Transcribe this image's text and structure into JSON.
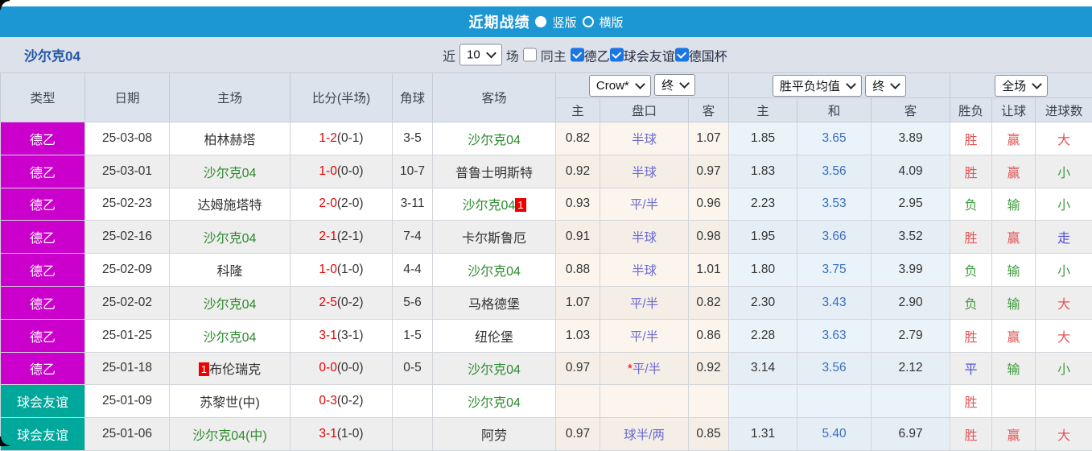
{
  "banner": {
    "title": "近期战绩",
    "vertical_label": "竖版",
    "horizontal_label": "横版",
    "selected_layout": "竖版"
  },
  "filter": {
    "team": "沙尔克04",
    "near_label": "近",
    "count": "10",
    "games_label": "场",
    "same_home_label": "同主",
    "same_home_checked": false,
    "league_filters": [
      "德乙",
      "球会友谊",
      "德国杯"
    ],
    "league_checked": [
      true,
      true,
      true
    ]
  },
  "table": {
    "main_headers": [
      "类型",
      "日期",
      "主场",
      "比分(半场)",
      "角球",
      "客场"
    ],
    "sub_headers": [
      "主",
      "盘口",
      "客",
      "主",
      "和",
      "客",
      "胜负",
      "让球",
      "进球数"
    ],
    "dropdowns": {
      "company": "Crow*",
      "company_period": "终",
      "avg": "胜平负均值",
      "avg_period": "终",
      "scope": "全场"
    },
    "rows": [
      {
        "type": "德乙",
        "type_class": "league-de2",
        "date": "25-03-08",
        "home": {
          "name": "柏林赫塔",
          "green": false,
          "badge": ""
        },
        "score": "1-2",
        "half": "(0-1)",
        "corners": "3-5",
        "away": {
          "name": "沙尔克04",
          "green": true,
          "badge": ""
        },
        "ah": {
          "home": "0.82",
          "line": "半球",
          "away": "1.07",
          "star": false
        },
        "op": {
          "home": "1.85",
          "draw": "3.65",
          "away": "3.89"
        },
        "result": {
          "text": "胜",
          "cls": "c-red"
        },
        "spread": {
          "text": "赢",
          "cls": "c-red"
        },
        "goals": {
          "text": "大",
          "cls": "c-red"
        }
      },
      {
        "type": "德乙",
        "type_class": "league-de2",
        "date": "25-03-01",
        "home": {
          "name": "沙尔克04",
          "green": true,
          "badge": ""
        },
        "score": "1-0",
        "half": "(0-0)",
        "corners": "10-7",
        "away": {
          "name": "普鲁士明斯特",
          "green": false,
          "badge": ""
        },
        "ah": {
          "home": "0.92",
          "line": "半球",
          "away": "0.97",
          "star": false
        },
        "op": {
          "home": "1.83",
          "draw": "3.56",
          "away": "4.09"
        },
        "result": {
          "text": "胜",
          "cls": "c-red"
        },
        "spread": {
          "text": "赢",
          "cls": "c-red"
        },
        "goals": {
          "text": "小",
          "cls": "c-green"
        }
      },
      {
        "type": "德乙",
        "type_class": "league-de2",
        "date": "25-02-23",
        "home": {
          "name": "达姆施塔特",
          "green": false,
          "badge": ""
        },
        "score": "2-0",
        "half": "(2-0)",
        "corners": "3-11",
        "away": {
          "name": "沙尔克04",
          "green": true,
          "badge": "1"
        },
        "ah": {
          "home": "0.93",
          "line": "平/半",
          "away": "0.96",
          "star": false
        },
        "op": {
          "home": "2.23",
          "draw": "3.53",
          "away": "2.95"
        },
        "result": {
          "text": "负",
          "cls": "c-green"
        },
        "spread": {
          "text": "输",
          "cls": "c-green"
        },
        "goals": {
          "text": "小",
          "cls": "c-green"
        }
      },
      {
        "type": "德乙",
        "type_class": "league-de2",
        "date": "25-02-16",
        "home": {
          "name": "沙尔克04",
          "green": true,
          "badge": ""
        },
        "score": "2-1",
        "half": "(2-1)",
        "corners": "7-4",
        "away": {
          "name": "卡尔斯鲁厄",
          "green": false,
          "badge": ""
        },
        "ah": {
          "home": "0.91",
          "line": "半球",
          "away": "0.98",
          "star": false
        },
        "op": {
          "home": "1.95",
          "draw": "3.66",
          "away": "3.52"
        },
        "result": {
          "text": "胜",
          "cls": "c-red"
        },
        "spread": {
          "text": "赢",
          "cls": "c-red"
        },
        "goals": {
          "text": "走",
          "cls": "c-blue"
        }
      },
      {
        "type": "德乙",
        "type_class": "league-de2",
        "date": "25-02-09",
        "home": {
          "name": "科隆",
          "green": false,
          "badge": ""
        },
        "score": "1-0",
        "half": "(1-0)",
        "corners": "4-4",
        "away": {
          "name": "沙尔克04",
          "green": true,
          "badge": ""
        },
        "ah": {
          "home": "0.88",
          "line": "半球",
          "away": "1.01",
          "star": false
        },
        "op": {
          "home": "1.80",
          "draw": "3.75",
          "away": "3.99"
        },
        "result": {
          "text": "负",
          "cls": "c-green"
        },
        "spread": {
          "text": "输",
          "cls": "c-green"
        },
        "goals": {
          "text": "小",
          "cls": "c-green"
        }
      },
      {
        "type": "德乙",
        "type_class": "league-de2",
        "date": "25-02-02",
        "home": {
          "name": "沙尔克04",
          "green": true,
          "badge": ""
        },
        "score": "2-5",
        "half": "(0-2)",
        "corners": "5-6",
        "away": {
          "name": "马格德堡",
          "green": false,
          "badge": ""
        },
        "ah": {
          "home": "1.07",
          "line": "平/半",
          "away": "0.82",
          "star": false
        },
        "op": {
          "home": "2.30",
          "draw": "3.43",
          "away": "2.90"
        },
        "result": {
          "text": "负",
          "cls": "c-green"
        },
        "spread": {
          "text": "输",
          "cls": "c-green"
        },
        "goals": {
          "text": "大",
          "cls": "c-red"
        }
      },
      {
        "type": "德乙",
        "type_class": "league-de2",
        "date": "25-01-25",
        "home": {
          "name": "沙尔克04",
          "green": true,
          "badge": ""
        },
        "score": "3-1",
        "half": "(3-1)",
        "corners": "1-5",
        "away": {
          "name": "纽伦堡",
          "green": false,
          "badge": ""
        },
        "ah": {
          "home": "1.03",
          "line": "平/半",
          "away": "0.86",
          "star": false
        },
        "op": {
          "home": "2.28",
          "draw": "3.63",
          "away": "2.79"
        },
        "result": {
          "text": "胜",
          "cls": "c-red"
        },
        "spread": {
          "text": "赢",
          "cls": "c-red"
        },
        "goals": {
          "text": "大",
          "cls": "c-red"
        }
      },
      {
        "type": "德乙",
        "type_class": "league-de2",
        "date": "25-01-18",
        "home": {
          "name": "布伦瑞克",
          "green": false,
          "badge": "1"
        },
        "score": "0-0",
        "half": "(0-0)",
        "corners": "0-5",
        "away": {
          "name": "沙尔克04",
          "green": true,
          "badge": ""
        },
        "ah": {
          "home": "0.97",
          "line": "平/半",
          "away": "0.92",
          "star": true
        },
        "op": {
          "home": "3.14",
          "draw": "3.56",
          "away": "2.12"
        },
        "result": {
          "text": "平",
          "cls": "c-blue"
        },
        "spread": {
          "text": "输",
          "cls": "c-green"
        },
        "goals": {
          "text": "小",
          "cls": "c-green"
        }
      },
      {
        "type": "球会友谊",
        "type_class": "league-friendly",
        "date": "25-01-09",
        "home": {
          "name": "苏黎世(中)",
          "green": false,
          "badge": ""
        },
        "score": "0-3",
        "half": "(0-2)",
        "corners": "",
        "away": {
          "name": "沙尔克04",
          "green": true,
          "badge": ""
        },
        "ah": {
          "home": "",
          "line": "",
          "away": "",
          "star": false
        },
        "op": {
          "home": "",
          "draw": "",
          "away": ""
        },
        "result": {
          "text": "胜",
          "cls": "c-red"
        },
        "spread": {
          "text": "",
          "cls": "c-none"
        },
        "goals": {
          "text": "",
          "cls": "c-none"
        }
      },
      {
        "type": "球会友谊",
        "type_class": "league-friendly",
        "date": "25-01-06",
        "home": {
          "name": "沙尔克04(中)",
          "green": true,
          "badge": ""
        },
        "score": "3-1",
        "half": "(1-0)",
        "corners": "",
        "away": {
          "name": "阿劳",
          "green": false,
          "badge": ""
        },
        "ah": {
          "home": "0.97",
          "line": "球半/两",
          "away": "0.85",
          "star": false
        },
        "op": {
          "home": "1.31",
          "draw": "5.40",
          "away": "6.97"
        },
        "result": {
          "text": "胜",
          "cls": "c-red"
        },
        "spread": {
          "text": "赢",
          "cls": "c-red"
        },
        "goals": {
          "text": "大",
          "cls": "c-red"
        }
      }
    ]
  },
  "colors": {
    "banner_blue": "#1d97d4",
    "league_de2_magenta": "#cc00cc",
    "league_friendly_teal": "#00a79b",
    "team_title_blue": "#2356a8",
    "tracked_team_green": "#2d8a2d",
    "score_red": "#e80000",
    "handicap_line_purple": "#6b6bd0",
    "draw_odds_blue": "#3a6fc0",
    "result_red": "#e25555",
    "result_green": "#3f9c3f",
    "result_blue": "#5050dd",
    "header_bg": "#dce3ed",
    "filterbar_bg": "#dde2ea",
    "alt_row_bg": "#eeeeee",
    "ah_col_bg": "#fbf5ed",
    "avg_col_bg": "#eaf3f9",
    "badge_red": "#ee0000"
  }
}
